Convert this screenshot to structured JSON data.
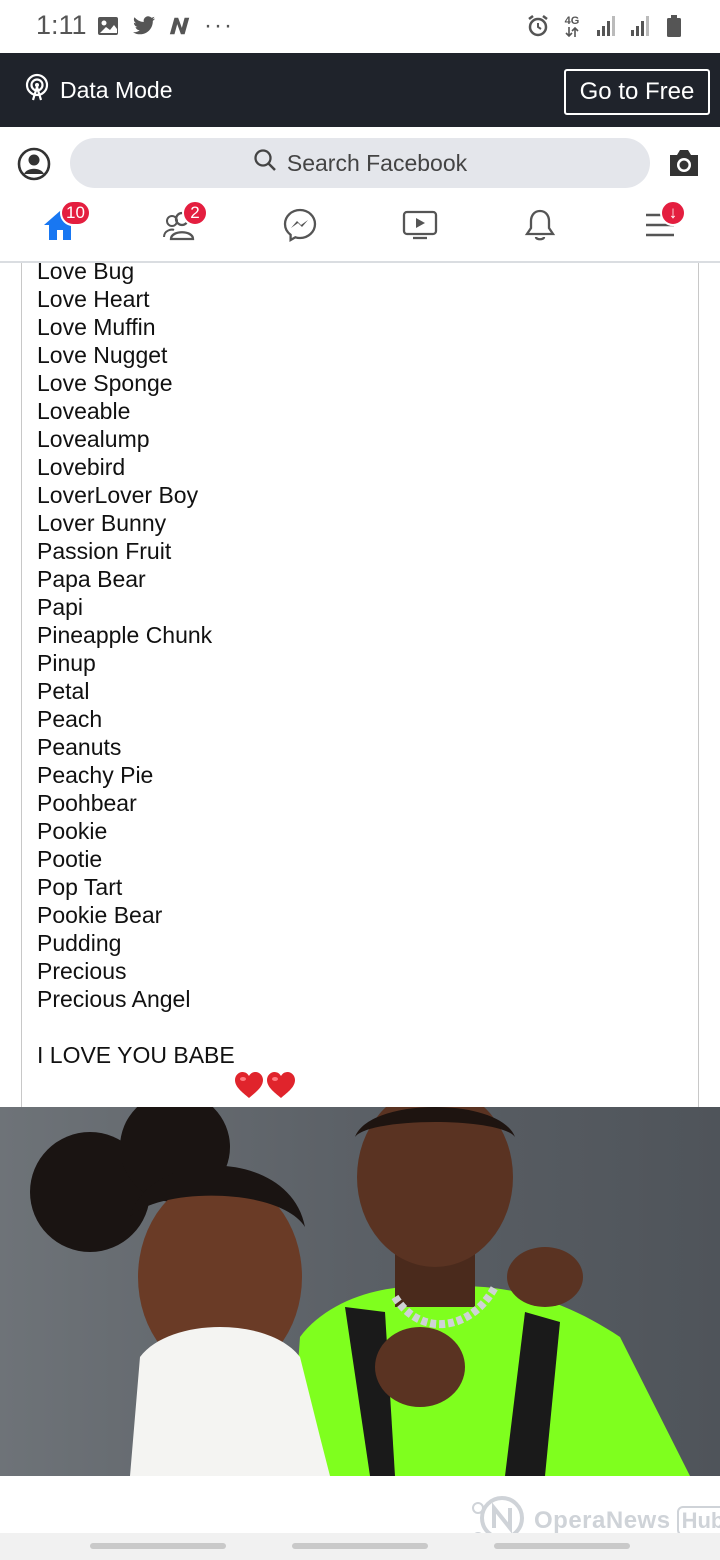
{
  "status_bar": {
    "time": "1:11",
    "left_icons": [
      "image-icon",
      "twitter-icon",
      "n-app-icon",
      "more-dots-icon"
    ],
    "right_icons": [
      "alarm-icon",
      "network-4g-icon",
      "signal-icon",
      "signal-icon",
      "battery-icon"
    ],
    "network_label": "4G",
    "more": "···"
  },
  "data_bar": {
    "label": "Data Mode",
    "button": "Go to Free"
  },
  "search": {
    "placeholder": "Search Facebook"
  },
  "nav": {
    "home_badge": "10",
    "friends_badge": "2",
    "menu_badge": "↓"
  },
  "post": {
    "names": [
      "Love Bug",
      "Love Heart",
      "Love Muffin",
      "Love Nugget",
      "Love Sponge",
      "Loveable",
      "Lovealump",
      "Lovebird",
      "LoverLover Boy",
      "Lover Bunny",
      "Passion Fruit",
      "Papa Bear",
      "Papi",
      "Pineapple Chunk",
      "Pinup",
      "Petal",
      "Peach",
      "Peanuts",
      "Peachy Pie",
      "Poohbear",
      "Pookie",
      "Pootie",
      "Pop Tart",
      "Pookie Bear",
      "Pudding",
      "Precious",
      "Precious Angel"
    ],
    "closing": "I LOVE YOU BABE",
    "hearts": [
      "heart-icon",
      "heart-icon"
    ]
  },
  "watermark": {
    "text": "OperaNews",
    "hub": "Hub"
  },
  "colors": {
    "data_bar_bg": "#1f232b",
    "brand_blue": "#1877f2",
    "badge_red": "#e41e3f",
    "search_bg": "#e4e6eb",
    "shirt_green": "#7fff1e"
  }
}
